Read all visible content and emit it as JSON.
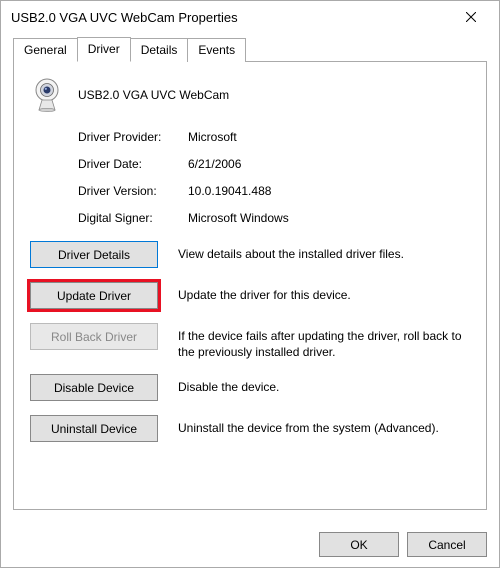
{
  "window": {
    "title": "USB2.0 VGA UVC WebCam Properties"
  },
  "tabs": {
    "general": "General",
    "driver": "Driver",
    "details": "Details",
    "events": "Events"
  },
  "device": {
    "name": "USB2.0 VGA UVC WebCam"
  },
  "info": {
    "provider_label": "Driver Provider:",
    "provider_value": "Microsoft",
    "date_label": "Driver Date:",
    "date_value": "6/21/2006",
    "version_label": "Driver Version:",
    "version_value": "10.0.19041.488",
    "signer_label": "Digital Signer:",
    "signer_value": "Microsoft Windows"
  },
  "actions": {
    "details_label": "Driver Details",
    "details_desc": "View details about the installed driver files.",
    "update_label": "Update Driver",
    "update_desc": "Update the driver for this device.",
    "rollback_label": "Roll Back Driver",
    "rollback_desc": "If the device fails after updating the driver, roll back to the previously installed driver.",
    "disable_label": "Disable Device",
    "disable_desc": "Disable the device.",
    "uninstall_label": "Uninstall Device",
    "uninstall_desc": "Uninstall the device from the system (Advanced)."
  },
  "footer": {
    "ok": "OK",
    "cancel": "Cancel"
  }
}
